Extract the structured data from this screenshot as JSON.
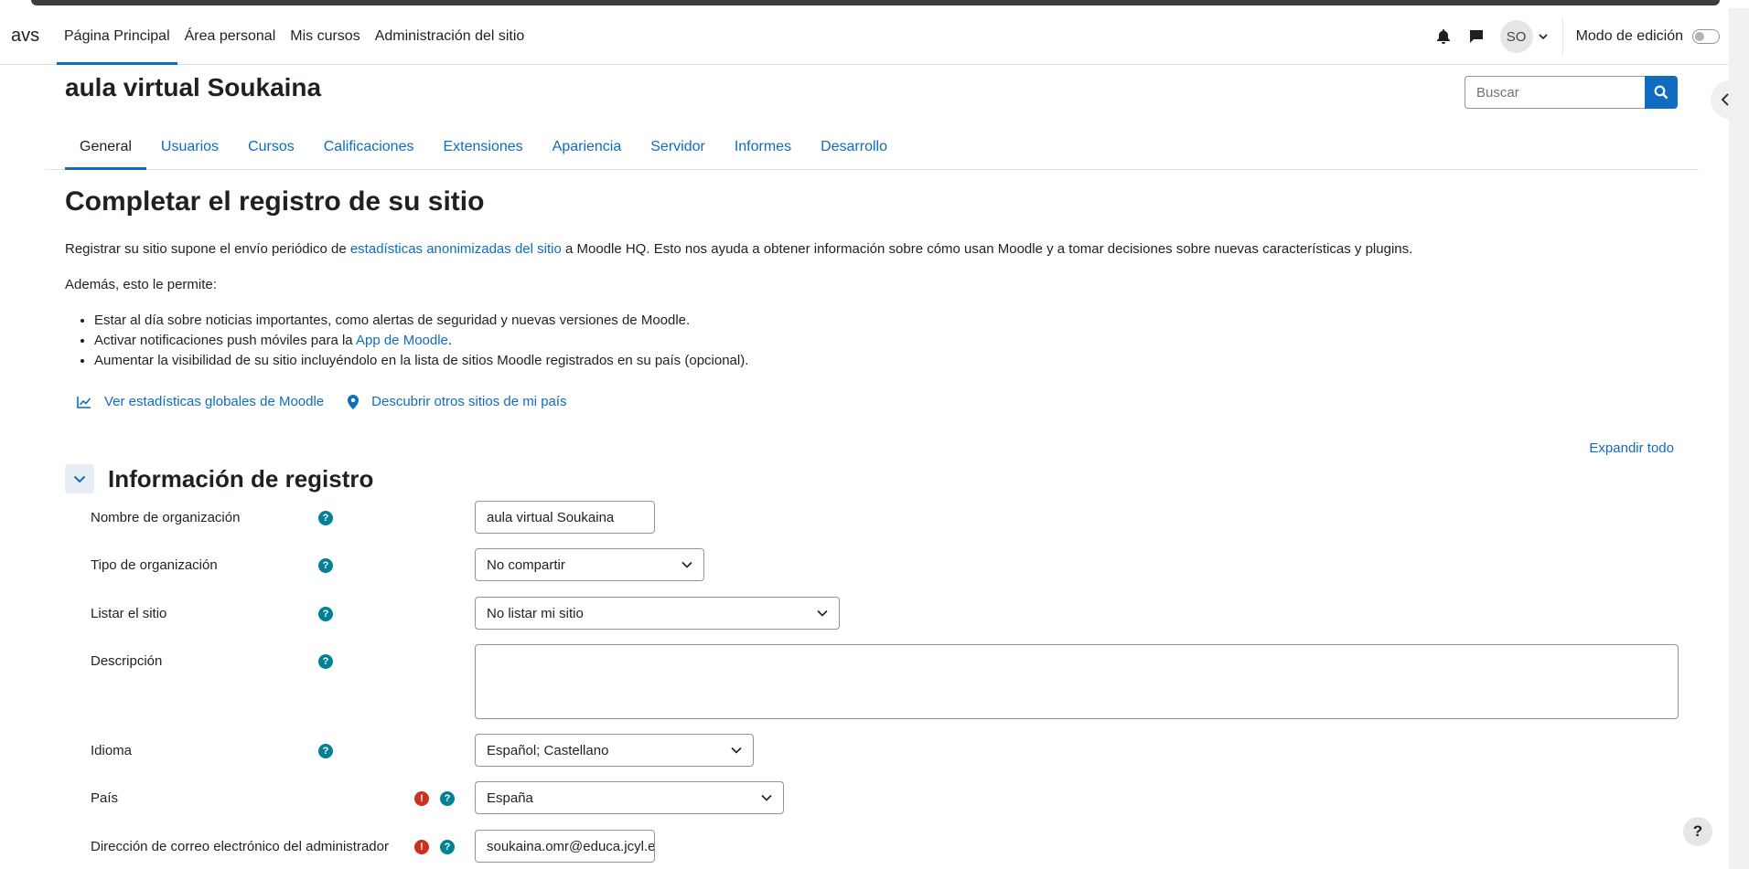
{
  "brand": "avs",
  "primary_nav": [
    "Página Principal",
    "Área personal",
    "Mis cursos",
    "Administración del sitio"
  ],
  "user": {
    "initials": "SO"
  },
  "edit_mode_label": "Modo de edición",
  "site_title": "aula virtual Soukaina",
  "search": {
    "placeholder": "Buscar"
  },
  "secondary_nav": [
    "General",
    "Usuarios",
    "Cursos",
    "Calificaciones",
    "Extensiones",
    "Apariencia",
    "Servidor",
    "Informes",
    "Desarrollo"
  ],
  "page_heading": "Completar el registro de su sitio",
  "intro": {
    "before": "Registrar su sitio supone el envío periódico de ",
    "link": "estadísticas anonimizadas del sitio",
    "after": " a Moodle HQ. Esto nos ayuda a obtener información sobre cómo usan Moodle y a tomar decisiones sobre nuevas características y plugins."
  },
  "allows_text": "Además, esto le permite:",
  "benefits": {
    "b1": "Estar al día sobre noticias importantes, como alertas de seguridad y nuevas versiones de Moodle.",
    "b2_before": "Activar notificaciones push móviles para la ",
    "b2_link": "App de Moodle",
    "b2_after": ".",
    "b3": "Aumentar la visibilidad de su sitio incluyéndolo en la lista de sitios Moodle registrados en su país (opcional)."
  },
  "quick_links": [
    "Ver estadísticas globales de Moodle",
    "Descubrir otros sitios de mi país"
  ],
  "expand_all": "Expandir todo",
  "section_title": "Información de registro",
  "form": [
    {
      "label": "Nombre de organización",
      "value": "aula virtual Soukaina"
    },
    {
      "label": "Tipo de organización",
      "value": "No compartir"
    },
    {
      "label": "Listar el sitio",
      "value": "No listar mi sitio"
    },
    {
      "label": "Descripción",
      "value": ""
    },
    {
      "label": "Idioma",
      "value": "Español; Castellano"
    },
    {
      "label": "País",
      "value": "España"
    },
    {
      "label": "Dirección de correo electrónico del administrador",
      "value": "soukaina.omr@educa.jcyl.es"
    }
  ],
  "help_fab": "?",
  "colors": {
    "primary": "#0f6cbf",
    "help": "#008196",
    "required": "#ca3120"
  }
}
